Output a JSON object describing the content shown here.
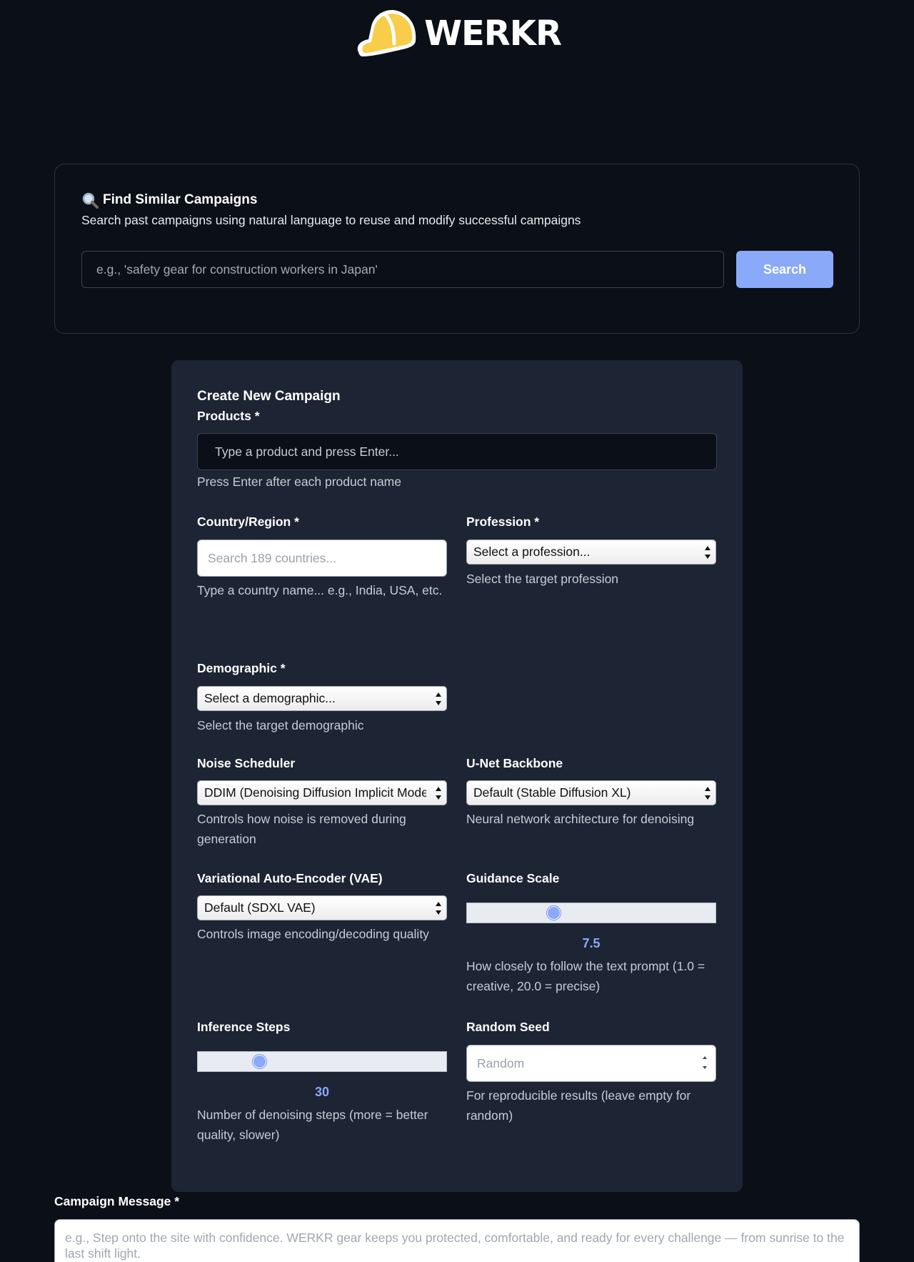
{
  "header": {
    "brand": "WERKR",
    "logo_icon": "hard-hat-icon"
  },
  "search": {
    "icon": "magnifying-glass-icon",
    "title": "Find Similar Campaigns",
    "description": "Search past campaigns using natural language to reuse and modify successful campaigns",
    "placeholder": "e.g., 'safety gear for construction workers in Japan'",
    "button_label": "Search"
  },
  "form": {
    "title": "Create New Campaign",
    "products": {
      "label": "Products *",
      "placeholder": "Type a product and press Enter...",
      "help": "Press Enter after each product name"
    },
    "country": {
      "label": "Country/Region *",
      "placeholder": "Search 189 countries...",
      "help": "Type a country name... e.g., India, USA, etc."
    },
    "profession": {
      "label": "Profession *",
      "selected": "Select a profession...",
      "help": "Select the target profession"
    },
    "demographic": {
      "label": "Demographic *",
      "selected": "Select a demographic...",
      "help": "Select the target demographic"
    },
    "noise_scheduler": {
      "label": "Noise Scheduler",
      "selected": "DDIM (Denoising Diffusion Implicit Models)",
      "help": "Controls how noise is removed during generation"
    },
    "unet": {
      "label": "U-Net Backbone",
      "selected": "Default (Stable Diffusion XL)",
      "help": "Neural network architecture for denoising"
    },
    "vae": {
      "label": "Variational Auto-Encoder (VAE)",
      "selected": "Default (SDXL VAE)",
      "help": "Controls image encoding/decoding quality"
    },
    "guidance": {
      "label": "Guidance Scale",
      "value": "7.5",
      "fraction": 0.35,
      "help": "How closely to follow the text prompt (1.0 = creative, 20.0 = precise)"
    },
    "inference": {
      "label": "Inference Steps",
      "value": "30",
      "fraction": 0.25,
      "help": "Number of denoising steps (more = better quality, slower)"
    },
    "seed": {
      "label": "Random Seed",
      "placeholder": "Random",
      "help": "For reproducible results (leave empty for random)"
    }
  },
  "campaign_message": {
    "label": "Campaign Message *",
    "placeholder": "e.g., Step onto the site with confidence. WERKR gear keeps you protected, comfortable, and ready for every challenge — from sunrise to the last shift light."
  },
  "colors": {
    "accent": "#8aa9f9",
    "background": "#0b0f17",
    "card": "#1d2433"
  }
}
